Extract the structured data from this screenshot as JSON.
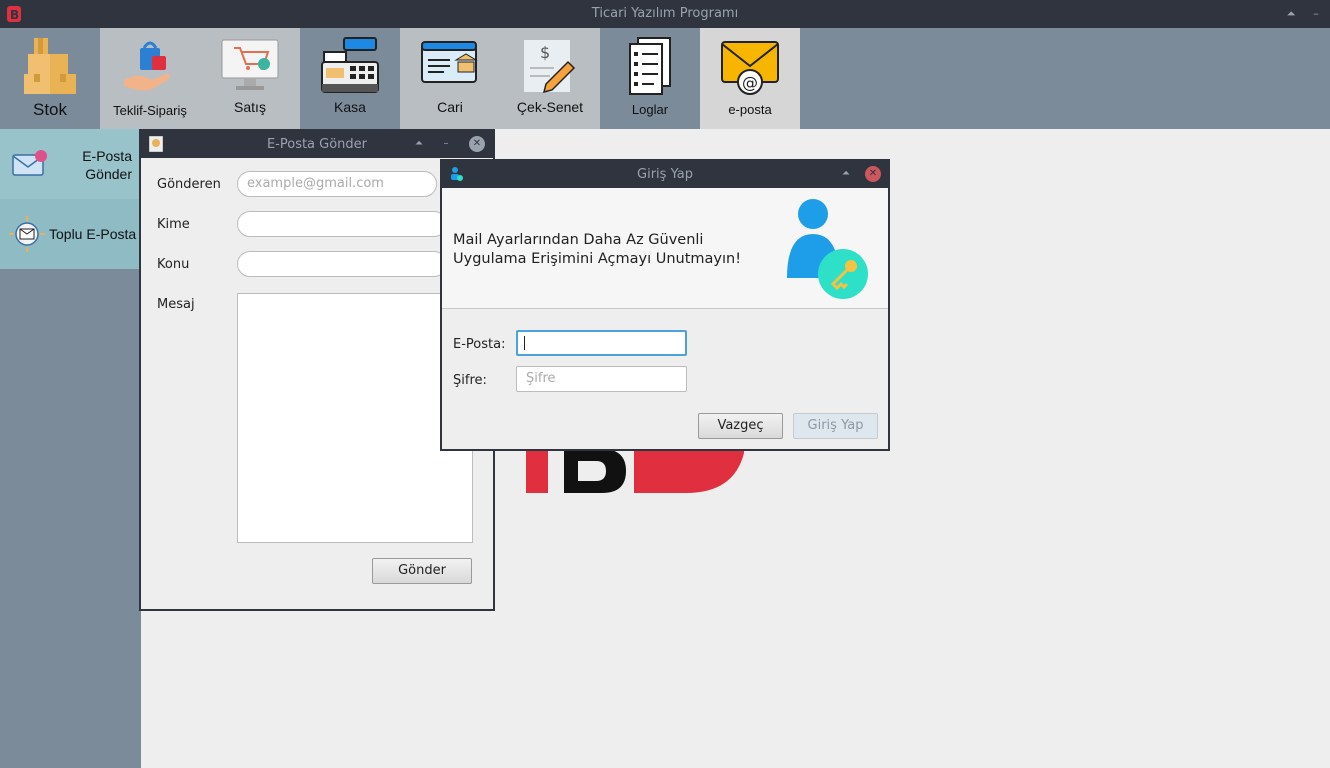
{
  "app": {
    "title": "Ticari Yazılım Programı"
  },
  "toolbar": {
    "items": [
      {
        "label": "Stok",
        "icon": "boxes-icon"
      },
      {
        "label": "Teklif-Sipariş",
        "icon": "shopping-hand-icon"
      },
      {
        "label": "Satış",
        "icon": "cart-monitor-icon"
      },
      {
        "label": "Kasa",
        "icon": "cash-register-icon"
      },
      {
        "label": "Cari",
        "icon": "bank-document-icon"
      },
      {
        "label": "Çek-Senet",
        "icon": "check-pen-icon"
      },
      {
        "label": "Loglar",
        "icon": "log-document-icon"
      },
      {
        "label": "e-posta",
        "icon": "email-envelope-icon"
      }
    ]
  },
  "sidebar": {
    "items": [
      {
        "label_line1": "E-Posta",
        "label_line2": "Gönder",
        "icon": "mail-send-icon"
      },
      {
        "label": "Toplu E-Posta",
        "icon": "bulk-mail-icon"
      }
    ]
  },
  "email_window": {
    "title": "E-Posta Gönder",
    "sender_label": "Gönderen",
    "sender_placeholder": "example@gmail.com",
    "to_label": "Kime",
    "subject_label": "Konu",
    "message_label": "Mesaj",
    "send_button": "Gönder"
  },
  "login_dialog": {
    "title": "Giriş Yap",
    "message_line1": "Mail Ayarlarından Daha Az Güvenli",
    "message_line2": "Uygulama Erişimini Açmayı Unutmayın!",
    "email_label": "E-Posta:",
    "email_value": "",
    "password_label": "Şifre:",
    "password_placeholder": "Şifre",
    "cancel_button": "Vazgeç",
    "login_button": "Giriş Yap"
  },
  "colors": {
    "titlebar": "#2f343f",
    "toolbar_bg": "#7b8b9a",
    "brand_red": "#e03040",
    "sidebar_item": "#8fbcc4",
    "close_red": "#cc575d"
  }
}
